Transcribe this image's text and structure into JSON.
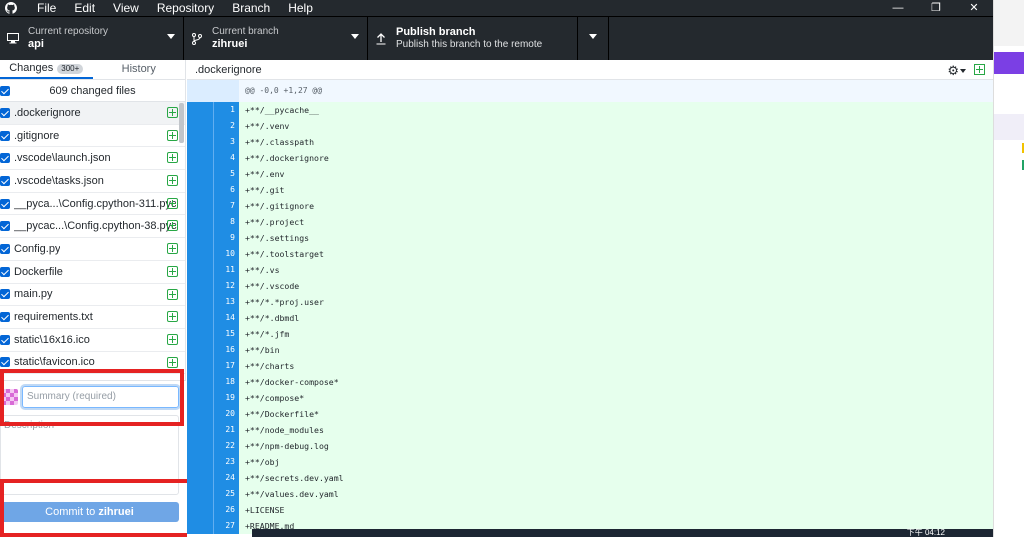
{
  "app": {
    "menu": [
      "File",
      "Edit",
      "View",
      "Repository",
      "Branch",
      "Help"
    ],
    "window_controls": [
      "—",
      "❐",
      "✕"
    ]
  },
  "toolbar": {
    "repo": {
      "label": "Current repository",
      "value": "api"
    },
    "branch": {
      "label": "Current branch",
      "value": "zihruei"
    },
    "publish": {
      "title": "Publish branch",
      "subtitle": "Publish this branch to the remote"
    }
  },
  "tabs": {
    "changes_label": "Changes",
    "changes_count": "300+",
    "history_label": "History"
  },
  "filelist": {
    "summary": "609 changed files",
    "files": [
      ".dockerignore",
      ".gitignore",
      ".vscode\\launch.json",
      ".vscode\\tasks.json",
      "__pyca...\\Config.cpython-311.pyc",
      "__pycac...\\Config.cpython-38.pyc",
      "Config.py",
      "Dockerfile",
      "main.py",
      "requirements.txt",
      "static\\16x16.ico",
      "static\\favicon.ico"
    ]
  },
  "commit": {
    "summary_placeholder": "Summary (required)",
    "description_placeholder": "Description",
    "button_prefix": "Commit to ",
    "button_branch": "zihruei"
  },
  "diff": {
    "file": ".dockerignore",
    "hunk": "@@ -0,0 +1,27 @@",
    "lines": [
      "+**/__pycache__",
      "+**/.venv",
      "+**/.classpath",
      "+**/.dockerignore",
      "+**/.env",
      "+**/.git",
      "+**/.gitignore",
      "+**/.project",
      "+**/.settings",
      "+**/.toolstarget",
      "+**/.vs",
      "+**/.vscode",
      "+**/*.*proj.user",
      "+**/*.dbmdl",
      "+**/*.jfm",
      "+**/bin",
      "+**/charts",
      "+**/docker-compose*",
      "+**/compose*",
      "+**/Dockerfile*",
      "+**/node_modules",
      "+**/npm-debug.log",
      "+**/obj",
      "+**/secrets.dev.yaml",
      "+**/values.dev.yaml",
      "+LICENSE",
      "+README.md"
    ]
  },
  "taskbar": {
    "clock": "下午 04:12"
  },
  "colors": {
    "accent": "#0366d6",
    "toolbar": "#24292e",
    "added_bg": "#e6ffed",
    "gutter": "#1f8de4",
    "highlight": "#e52222"
  }
}
